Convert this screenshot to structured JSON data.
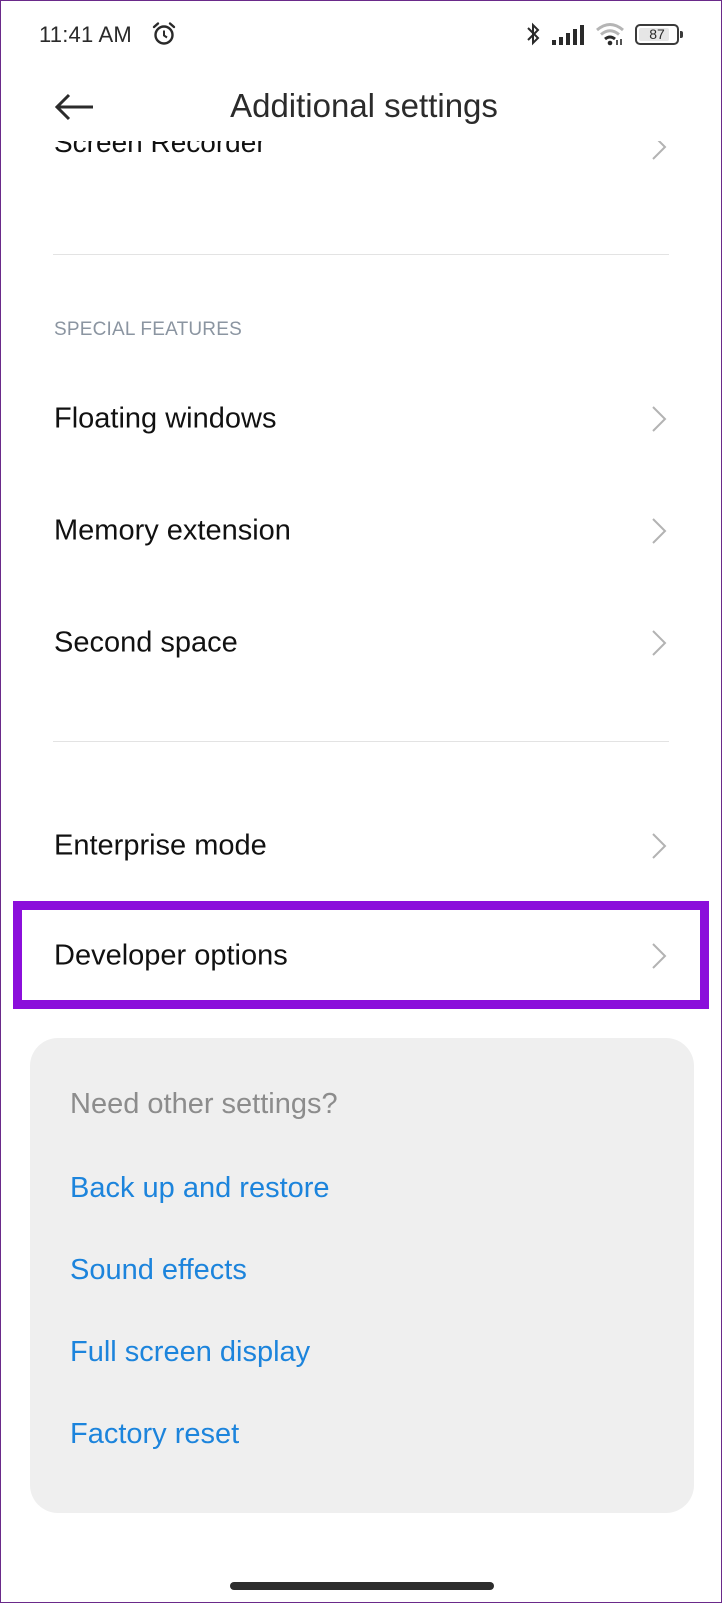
{
  "status_bar": {
    "time": "11:41 AM",
    "icons": [
      "alarm-icon",
      "bluetooth-icon",
      "signal-icon",
      "wifi-icon",
      "battery-icon"
    ],
    "battery_level": "87"
  },
  "header": {
    "back_icon": "arrow-left-icon",
    "title": "Additional settings"
  },
  "partial_item": {
    "label": "Screen Recorder"
  },
  "sections": [
    {
      "title": "SPECIAL FEATURES",
      "items": [
        {
          "label": "Floating windows"
        },
        {
          "label": "Memory extension"
        },
        {
          "label": "Second space"
        }
      ]
    },
    {
      "title": "",
      "items": [
        {
          "label": "Enterprise mode"
        },
        {
          "label": "Developer options",
          "highlighted": true
        }
      ]
    }
  ],
  "highlight_color": "#8b0fdb",
  "other_settings": {
    "title": "Need other settings?",
    "links": [
      {
        "label": "Back up and restore"
      },
      {
        "label": "Sound effects"
      },
      {
        "label": "Full screen display"
      },
      {
        "label": "Factory reset"
      }
    ],
    "link_color": "#1c84dc"
  }
}
